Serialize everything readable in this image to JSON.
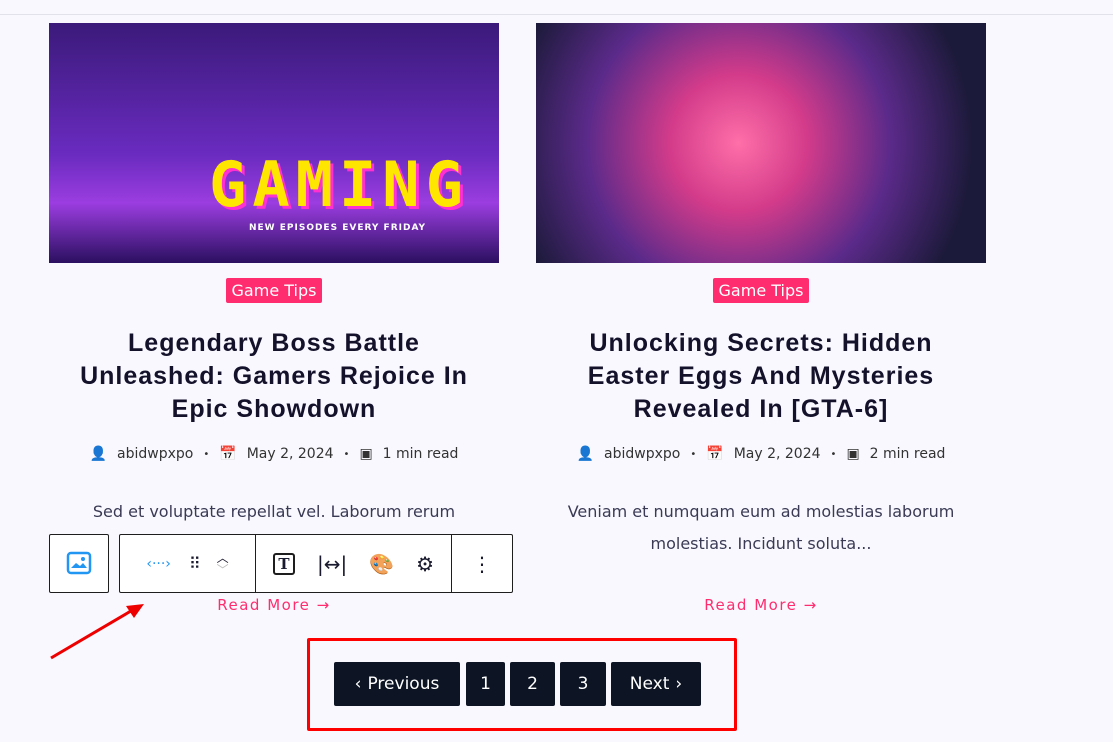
{
  "posts": [
    {
      "image_text": "GAMING",
      "image_subtext": "NEW EPISODES EVERY FRIDAY",
      "category": "Game Tips",
      "title": "Legendary Boss Battle Unleashed: Gamers Rejoice In Epic Showdown",
      "author": "abidwpxpo",
      "date": "May 2, 2024",
      "read_time": "1 min read",
      "excerpt": "Sed et voluptate repellat vel. Laborum rerum",
      "read_more": "Read More"
    },
    {
      "category": "Game Tips",
      "title": "Unlocking Secrets: Hidden Easter Eggs And Mysteries Revealed In [GTA-6]",
      "author": "abidwpxpo",
      "date": "May 2, 2024",
      "read_time": "2 min read",
      "excerpt": "Veniam et numquam eum ad molestias laborum molestias. Incidunt soluta...",
      "read_more": "Read More"
    }
  ],
  "pagination": {
    "previous": "Previous",
    "pages": [
      "1",
      "2",
      "3"
    ],
    "next": "Next"
  },
  "colors": {
    "accent": "#ff2d6f",
    "button": "#0d1525",
    "highlight": "#ff0000"
  }
}
